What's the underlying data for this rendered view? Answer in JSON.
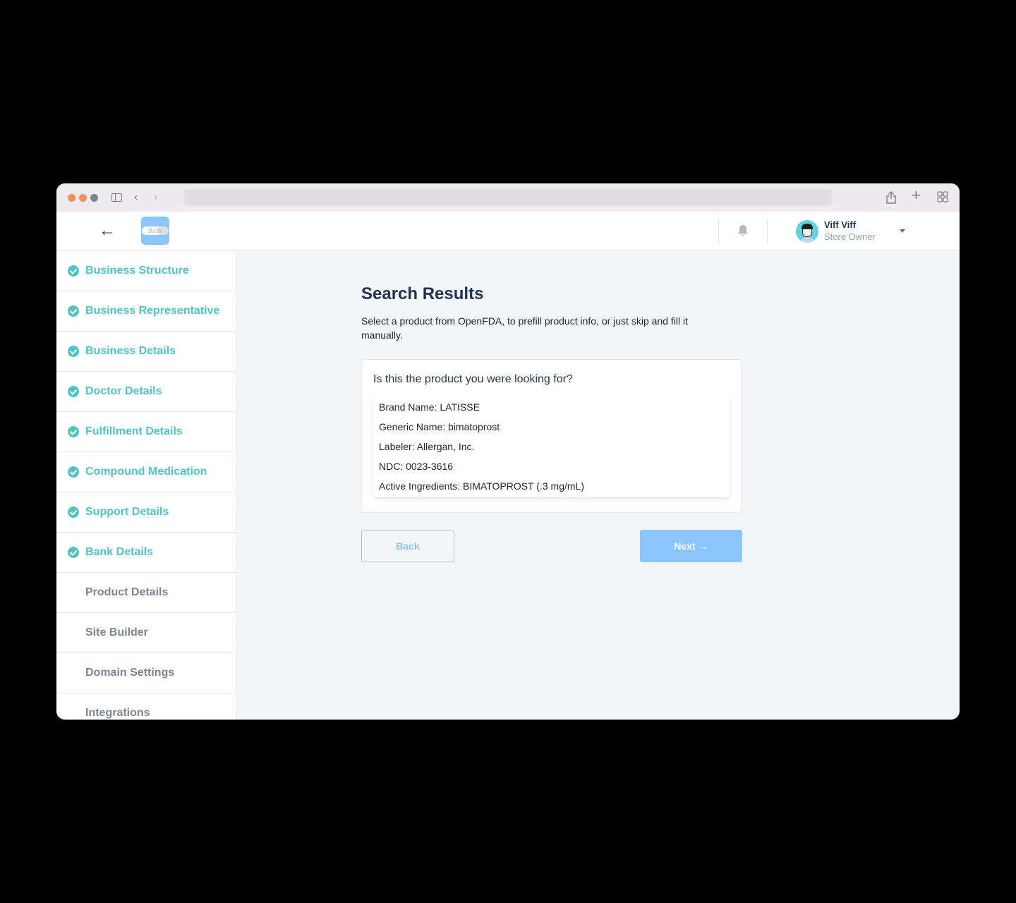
{
  "browser": {
    "url": "",
    "icons": [
      "sidebar-toggle-icon",
      "chevron-left-icon",
      "chevron-right-icon",
      "share-icon",
      "plus-icon",
      "tabs-grid-icon"
    ]
  },
  "header": {
    "back_icon": "←",
    "logo_text": "Bask",
    "user": {
      "name": "Viff Viff",
      "role": "Store Owner"
    }
  },
  "sidebar": {
    "steps": [
      {
        "label": "Business Structure",
        "completed": true
      },
      {
        "label": "Business Representative",
        "completed": true
      },
      {
        "label": "Business Details",
        "completed": true
      },
      {
        "label": "Doctor Details",
        "completed": true
      },
      {
        "label": "Fulfillment Details",
        "completed": true
      },
      {
        "label": "Compound Medication",
        "completed": true
      },
      {
        "label": "Support Details",
        "completed": true
      },
      {
        "label": "Bank Details",
        "completed": true
      },
      {
        "label": "Product Details",
        "completed": false
      },
      {
        "label": "Site Builder",
        "completed": false
      },
      {
        "label": "Domain Settings",
        "completed": false
      },
      {
        "label": "Integrations",
        "completed": false
      }
    ]
  },
  "main": {
    "title": "Search Results",
    "subtitle": "Select a product from OpenFDA, to prefill product info, or just skip and fill it manually.",
    "card": {
      "question": "Is this the product you were looking for?",
      "product": {
        "brand_name": "Brand Name: LATISSE",
        "generic_name": "Generic Name: bimatoprost",
        "labeler": "Labeler: Allergan, Inc.",
        "ndc": "NDC: 0023-3616",
        "active_ingredients": "Active Ingredients: BIMATOPROST (.3 mg/mL)"
      }
    },
    "buttons": {
      "back": "Back",
      "next": "Next →"
    }
  },
  "colors": {
    "accent": "#4fc4c4",
    "primary_light": "#8bc6fb",
    "heading": "#1d3457"
  }
}
